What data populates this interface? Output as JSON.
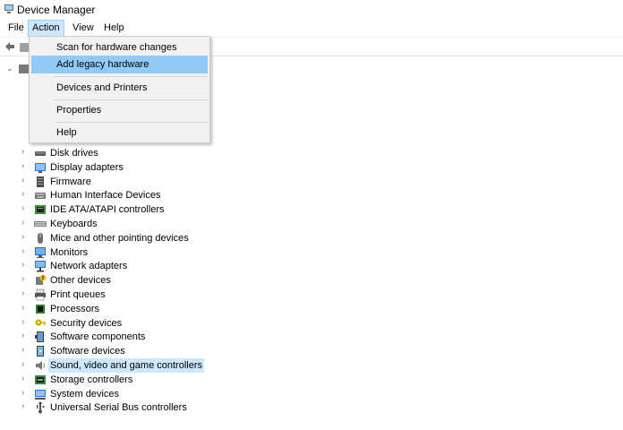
{
  "window": {
    "title": "Device Manager"
  },
  "menubar": {
    "file": "File",
    "action": "Action",
    "view": "View",
    "help": "Help"
  },
  "action_menu": {
    "items": [
      "Scan for hardware changes",
      "Add legacy hardware",
      "Devices and Printers",
      "Properties",
      "Help"
    ],
    "highlighted": "Add legacy hardware"
  },
  "tree": {
    "chevron": "›",
    "root_chevron": "⌄",
    "devices": [
      {
        "label": "Disk drives",
        "icon": "disk-drive-icon"
      },
      {
        "label": "Display adapters",
        "icon": "display-adapter-icon"
      },
      {
        "label": "Firmware",
        "icon": "firmware-icon"
      },
      {
        "label": "Human Interface Devices",
        "icon": "hid-icon"
      },
      {
        "label": "IDE ATA/ATAPI controllers",
        "icon": "ide-controller-icon"
      },
      {
        "label": "Keyboards",
        "icon": "keyboard-icon"
      },
      {
        "label": "Mice and other pointing devices",
        "icon": "mouse-icon"
      },
      {
        "label": "Monitors",
        "icon": "monitor-icon"
      },
      {
        "label": "Network adapters",
        "icon": "network-adapter-icon"
      },
      {
        "label": "Other devices",
        "icon": "other-device-icon"
      },
      {
        "label": "Print queues",
        "icon": "printer-icon"
      },
      {
        "label": "Processors",
        "icon": "processor-icon"
      },
      {
        "label": "Security devices",
        "icon": "security-device-icon"
      },
      {
        "label": "Software components",
        "icon": "software-component-icon"
      },
      {
        "label": "Software devices",
        "icon": "software-device-icon"
      },
      {
        "label": "Sound, video and game controllers",
        "icon": "sound-icon"
      },
      {
        "label": "Storage controllers",
        "icon": "storage-controller-icon"
      },
      {
        "label": "System devices",
        "icon": "system-device-icon"
      },
      {
        "label": "Universal Serial Bus controllers",
        "icon": "usb-icon"
      }
    ],
    "selected": "Sound, video and game controllers"
  },
  "colors": {
    "menu_highlight": "#91c9f7",
    "selection": "#cce8ff",
    "menu_bg": "#f2f2f2"
  }
}
